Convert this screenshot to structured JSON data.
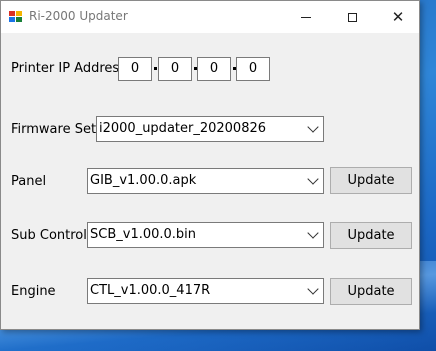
{
  "window": {
    "title": "Ri-2000 Updater"
  },
  "printer_ip": {
    "label": "Printer IP Address",
    "octets": [
      "0",
      "0",
      "0",
      "0"
    ]
  },
  "firmware_set": {
    "label": "Firmware Set",
    "selected": "i2000_updater_20200826"
  },
  "rows": [
    {
      "label": "Panel",
      "selected": "GIB_v1.00.0.apk",
      "button": "Update"
    },
    {
      "label": "Sub Control",
      "selected": "SCB_v1.00.0.bin",
      "button": "Update"
    },
    {
      "label": "Engine",
      "selected": "CTL_v1.00.0_417R",
      "button": "Update"
    }
  ],
  "icons": {
    "app": "app-icon",
    "minimize": "minimize-icon",
    "maximize": "maximize-icon",
    "close": "close-icon",
    "dropdown": "chevron-down-icon"
  }
}
